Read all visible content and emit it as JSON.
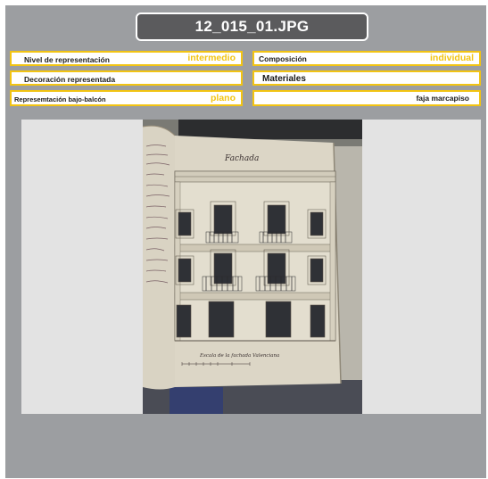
{
  "title": "12_015_01.JPG",
  "fields": {
    "nivel": {
      "label": "Nivel de representación",
      "value": "intermedio"
    },
    "composicion": {
      "label": "Composición",
      "value": "individual"
    },
    "decoracion": {
      "label": "Decoración representada",
      "value": ""
    },
    "materiales": {
      "label": "Materiales",
      "value": ""
    },
    "representacion": {
      "label": "Represemtación bajo-balcón",
      "value": "plano"
    },
    "materiales_val": {
      "label": "",
      "value": "faja marcapiso"
    }
  },
  "colors": {
    "accent": "#f2c413",
    "panel": "#9c9ea1",
    "title_bg": "#5b5b5d"
  },
  "image": {
    "handwritten_header": "Fachada",
    "handwritten_caption": "Escala de la fachada Valenciana"
  }
}
